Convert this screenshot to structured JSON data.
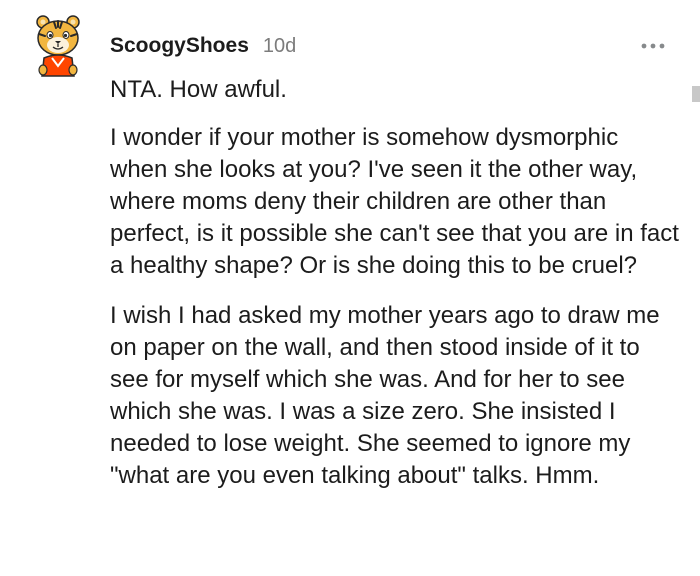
{
  "comment": {
    "username": "ScoogyShoes",
    "timestamp": "10d",
    "more_icon": "more-horizontal-icon",
    "avatar_icon": "tiger-avatar-icon",
    "paragraphs": [
      "NTA. How awful.",
      "I wonder if your mother is somehow dysmorphic when she looks at you? I've seen it the other way, where moms deny their children are other than perfect, is it possible she can't see that you are in fact a healthy shape? Or is she doing this to be cruel?",
      "I wish I had asked my mother years ago to draw me on paper on the wall, and then stood inside of it to see for myself which she was. And for her to see which she was. I was a size zero. She insisted I needed to lose weight. She seemed to ignore my \"what are you even talking about\" talks. Hmm."
    ]
  },
  "colors": {
    "text": "#1c1c1c",
    "meta": "#7c7c7c",
    "avatar_fur": "#f2b640",
    "avatar_shirt": "#ff4500"
  }
}
